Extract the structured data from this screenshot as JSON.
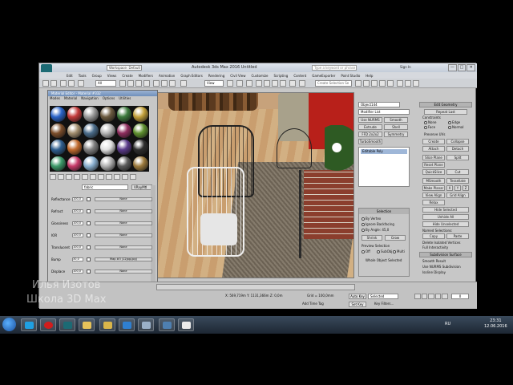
{
  "window": {
    "title": "Autodesk 3ds Max 2016    Untitled",
    "workspace": "Workspace: Default",
    "search_placeholder": "Type a keyword or phrase",
    "sign_in": "Sign In",
    "buttons": [
      "—",
      "□",
      "✕"
    ]
  },
  "menu": [
    "Edit",
    "Tools",
    "Group",
    "Views",
    "Create",
    "Modifiers",
    "Animation",
    "Graph Editors",
    "Rendering",
    "Civil View",
    "Customize",
    "Scripting",
    "Content",
    "GameExporter",
    "Point Studio",
    "Help"
  ],
  "toolbar": {
    "filter": "All",
    "view": "View",
    "create_selection_set": "Create Selection Se"
  },
  "material_editor": {
    "title": "Material Editor - Material #332",
    "menu": [
      "Modes",
      "Material",
      "Navigation",
      "Options",
      "Utilities"
    ],
    "material_name": "fabric",
    "material_type": "VRayMtl",
    "sphere_colors": [
      "#2a63c7",
      "#c43b3b",
      "#9a9a9a",
      "#6b5a3f",
      "#3d7a3d",
      "#c2a03a",
      "#7c4e2b",
      "#a38f70",
      "#4a6c8a",
      "#b5b5b5",
      "#8f2e5e",
      "#5e8f2e",
      "#2e5e8f",
      "#c26b2e",
      "#7f7f7f",
      "#e0e0e0",
      "#5a3a8a",
      "#2d2d2d",
      "#3d9a6a",
      "#c83c6a",
      "#8ab0d0",
      "#b0b0b0",
      "#5c5c5c",
      "#9c7a3c"
    ],
    "maps": [
      {
        "label": "Reflectance",
        "value": "100,0",
        "slot": "None"
      },
      {
        "label": "Refract",
        "value": "100,0",
        "slot": "None"
      },
      {
        "label": "Glossiness",
        "value": "100,0",
        "slot": "None"
      },
      {
        "label": "IOR",
        "value": "100,0",
        "slot": "None"
      },
      {
        "label": "Translucent",
        "value": "100,0",
        "slot": "None"
      },
      {
        "label": "Bump",
        "value": "30,0",
        "slot": "Map #3 (12jpg.jpg)"
      },
      {
        "label": "Displace",
        "value": "100,0",
        "slot": "None"
      },
      {
        "label": "Opacity",
        "value": "100,0",
        "slot": "None"
      },
      {
        "label": "Environment",
        "value": "",
        "slot": "None"
      }
    ]
  },
  "command_panel": {
    "object_name": "Object144",
    "modifier_list": "Modifier List",
    "buttons_left": [
      "Use NURMS",
      "Smooth",
      "Extrude",
      "Shell",
      "FFD 2x2x2",
      "Symmetry",
      "TurboSmooth"
    ],
    "stack_item": "Editable Poly",
    "selection_title": "Selection",
    "selection_text": [
      "By Vertex",
      "Ignore Backfacing",
      "By Angle: 45,0",
      "Shrink",
      "Grow",
      "Preview Selection",
      "Off",
      "SubObj",
      "Multi",
      "Whole Object Selected"
    ],
    "right_titles": [
      "Edit Geometry",
      "Subdivision Surface"
    ],
    "right_buttons": [
      "Repeat Last",
      "Create",
      "Collapse",
      "Attach",
      "Detach",
      "Slice Plane",
      "Split",
      "Reset Plane",
      "QuickSlice",
      "Cut",
      "MSmooth",
      "Tessellate",
      "Make Planar",
      "X",
      "Y",
      "Z",
      "View Align",
      "Grid Align",
      "Relax",
      "Hide Selected",
      "Unhide All",
      "Hide Unselected",
      "Copy",
      "Paste"
    ],
    "right_text": [
      "Constraints",
      "None",
      "Edge",
      "Face",
      "Normal",
      "Preserve UVs",
      "Named Selections:",
      "Delete Isolated Vertices",
      "Full Interactivity",
      "Smooth Result",
      "Use NURMS Subdivision",
      "Isoline Display"
    ]
  },
  "status": {
    "coords": "X: 569,719m   Y: 1131,366m   Z: 0,0m",
    "grid": "Grid = 100,0mm",
    "autokey": "Auto Key",
    "selected": "Selected",
    "add_time_tag": "Add Time Tag",
    "set_key": "Set Key",
    "key_filters": "Key Filters...",
    "frame": "0"
  },
  "taskbar": {
    "apps": [
      "skype",
      "opera",
      "3dsmax",
      "folder",
      "explorer",
      "photos",
      "notes",
      "corona"
    ],
    "lang": "RU",
    "time": "23:31",
    "date": "12.06.2016"
  },
  "watermark": [
    "Илья Изотов",
    "Школа 3D Max"
  ]
}
